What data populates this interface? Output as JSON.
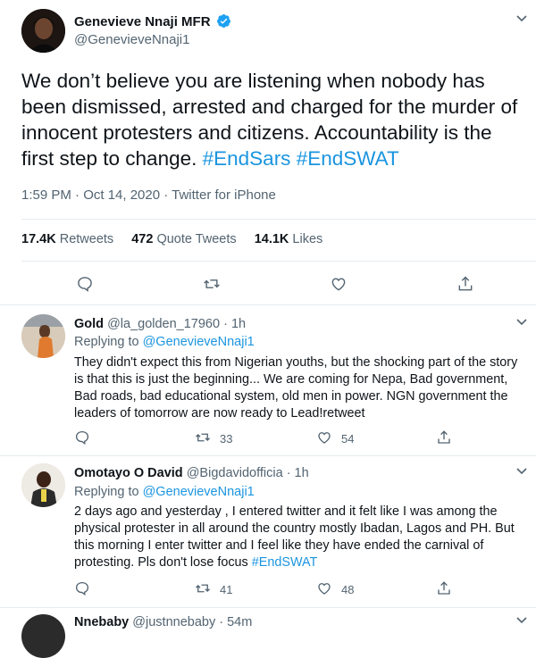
{
  "main_tweet": {
    "author_name": "Genevieve Nnaji MFR",
    "handle": "@GenevieveNnaji1",
    "text_plain": "We don’t believe you are listening when nobody has been dismissed, arrested and charged for the murder of innocent protesters and citizens. Accountability is the first step to change.",
    "hashtags": [
      "#EndSars",
      "#EndSWAT"
    ],
    "timestamp": "1:59 PM · Oct 14, 2020 · Twitter for iPhone",
    "stats": {
      "retweets_count": "17.4K",
      "retweets_label": "Retweets",
      "quotes_count": "472",
      "quotes_label": "Quote Tweets",
      "likes_count": "14.1K",
      "likes_label": "Likes"
    }
  },
  "replies": [
    {
      "author_name": "Gold",
      "handle": "@la_golden_17960",
      "time": "· 1h",
      "replying_prefix": "Replying to",
      "replying_to": "@GenevieveNnaji1",
      "text": "They didn't expect this from Nigerian youths, but the shocking part of the story is that this is just the beginning... We are coming for Nepa, Bad government, Bad roads, bad educational system, old men in power. NGN government the leaders of tomorrow are now ready to Lead!retweet",
      "retweets": "33",
      "likes": "54"
    },
    {
      "author_name": "Omotayo O David",
      "handle": "@Bigdavidofficia",
      "time": "· 1h",
      "replying_prefix": "Replying to",
      "replying_to": "@GenevieveNnaji1",
      "text": "2 days ago and yesterday , I entered twitter and it felt like I was among the physical protester in all around the country mostly Ibadan, Lagos and PH. But this morning I enter twitter and I feel like they have ended the carnival of protesting. Pls don't lose focus",
      "hashtag": "#EndSWAT",
      "retweets": "41",
      "likes": "48"
    },
    {
      "author_name": "Nnebaby",
      "handle": "@justnnebaby",
      "time": "· 54m"
    }
  ],
  "colors": {
    "link": "#1b95e0",
    "verified": "#1da1f2",
    "muted": "#536471",
    "divider": "#e6ecf0"
  }
}
